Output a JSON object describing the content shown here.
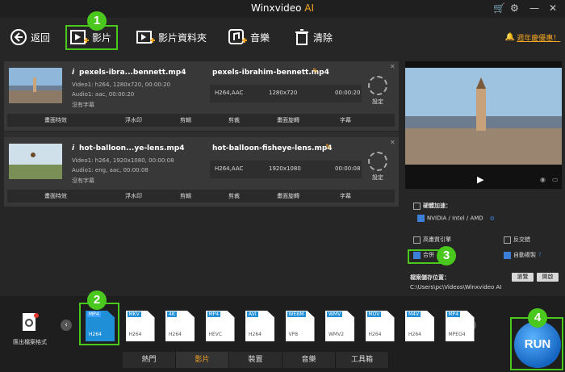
{
  "window": {
    "title": "Winxvideo",
    "title_suffix": "AI",
    "cart": "🛒",
    "gear": "⚙",
    "min": "—",
    "close": "✕"
  },
  "toolbar": {
    "back": "返回",
    "video": "影片",
    "folder": "影片資料夾",
    "music": "音樂",
    "clear": "清除",
    "promo": "週年慶優惠！"
  },
  "files": [
    {
      "src_name": "pexels-ibra...bennett.mp4",
      "video": "Video1: h264, 1280x720, 00:00:20",
      "audio": "Audio1: aac, 00:00:20",
      "subtitle": "沒有字幕",
      "out_name": "pexels-ibrahim-bennett.mp4",
      "codec": "H264,AAC",
      "res": "1280x720",
      "dur": "00:00:20",
      "settings": "設定"
    },
    {
      "src_name": "hot-balloon...ye-lens.mp4",
      "video": "Video1: h264, 1920x1080, 00:00:08",
      "audio": "Audio1: eng, aac, 00:00:08",
      "subtitle": "沒有字幕",
      "out_name": "hot-balloon-fisheye-lens.mp4",
      "codec": "H264,AAC",
      "res": "1920x1080",
      "dur": "00:00:08",
      "settings": "設定"
    }
  ],
  "actions": [
    "畫面特效",
    "浮水印",
    "剪輯",
    "剪裁",
    "畫面旋轉",
    "字幕"
  ],
  "settings": {
    "hw_accel": "硬體加速：",
    "hw_opts": "NVIDIA / Intel / AMD",
    "hq_engine": "高畫質引擎",
    "deinterlace": "反交錯",
    "merge": "合併",
    "auto_copy": "自動複製",
    "help": "?",
    "output_label": "檔案儲存位置：",
    "browse": "瀏覽",
    "open": "開啟",
    "output_path": "C:\\Users\\pc\\Videos\\Winxvideo AI"
  },
  "formats": [
    {
      "top": "MP4",
      "bottom": "H264",
      "selected": true
    },
    {
      "top": "MKV",
      "bottom": "H264"
    },
    {
      "top": "4K",
      "bottom": "H264"
    },
    {
      "top": "MP4",
      "bottom": "HEVC"
    },
    {
      "top": "AVI",
      "bottom": "H264"
    },
    {
      "top": "WEBM",
      "bottom": "VP8"
    },
    {
      "top": "WMV",
      "bottom": "WMV2"
    },
    {
      "top": "MOV",
      "bottom": "H264"
    },
    {
      "top": "M4V",
      "bottom": "H264"
    },
    {
      "top": "MP4",
      "bottom": "MPEG4"
    }
  ],
  "export_label": "匯出檔案格式",
  "tabs": [
    "熱門",
    "影片",
    "裝置",
    "音樂",
    "工具箱"
  ],
  "run": "RUN",
  "badges": [
    "1",
    "2",
    "3",
    "4"
  ],
  "colors": {
    "accent": "#4bc81e",
    "brand": "#1f8fd8",
    "orange": "#f5a623"
  }
}
